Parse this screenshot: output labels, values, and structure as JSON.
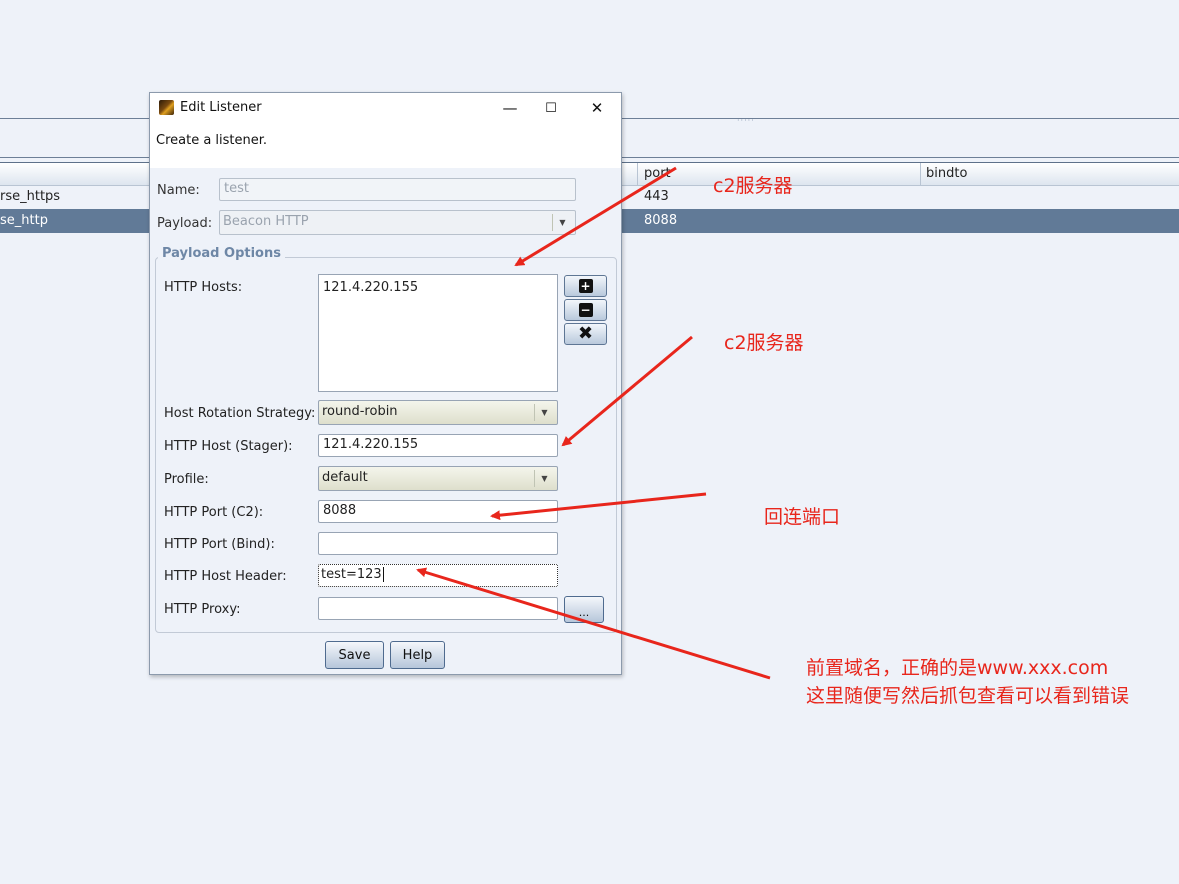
{
  "background_app": {
    "columns": [
      "port",
      "bindto"
    ],
    "rows": [
      {
        "name": "rse_https",
        "port": "443",
        "selected": false
      },
      {
        "name": "se_http",
        "port": "8088",
        "selected": true
      }
    ],
    "splitter_grip": "·····"
  },
  "dialog": {
    "title": "Edit Listener",
    "icon": "app-icon",
    "controls": {
      "minimize": "—",
      "maximize": "☐",
      "close": "✕"
    },
    "description": "Create a listener.",
    "name_label": "Name:",
    "name_value": "test",
    "payload_label": "Payload:",
    "payload_value": "Beacon HTTP",
    "group_title": "Payload Options",
    "fields": {
      "http_hosts": {
        "label": "HTTP Hosts:",
        "value": "121.4.220.155"
      },
      "host_rotation": {
        "label": "Host Rotation Strategy:",
        "value": "round-robin"
      },
      "http_host_stager": {
        "label": "HTTP Host (Stager):",
        "value": "121.4.220.155"
      },
      "profile": {
        "label": "Profile:",
        "value": "default"
      },
      "http_port_c2": {
        "label": "HTTP Port (C2):",
        "value": "8088"
      },
      "http_port_bind": {
        "label": "HTTP Port (Bind):",
        "value": ""
      },
      "http_host_header": {
        "label": "HTTP Host Header:",
        "value": "test=123"
      },
      "http_proxy": {
        "label": "HTTP Proxy:",
        "value": "",
        "button": "..."
      }
    },
    "side_buttons": {
      "add": "+",
      "remove": "−",
      "clear": "✖"
    },
    "buttons": {
      "save": "Save",
      "help": "Help"
    }
  },
  "annotations": {
    "c2_server_1": "c2服务器",
    "c2_server_2": "c2服务器",
    "callback_port": "回连端口",
    "host_header_note_line1": "前置域名，正确的是www.xxx.com",
    "host_header_note_line2": "这里随便写然后抓包查看可以看到错误",
    "color": "#e8261c"
  }
}
